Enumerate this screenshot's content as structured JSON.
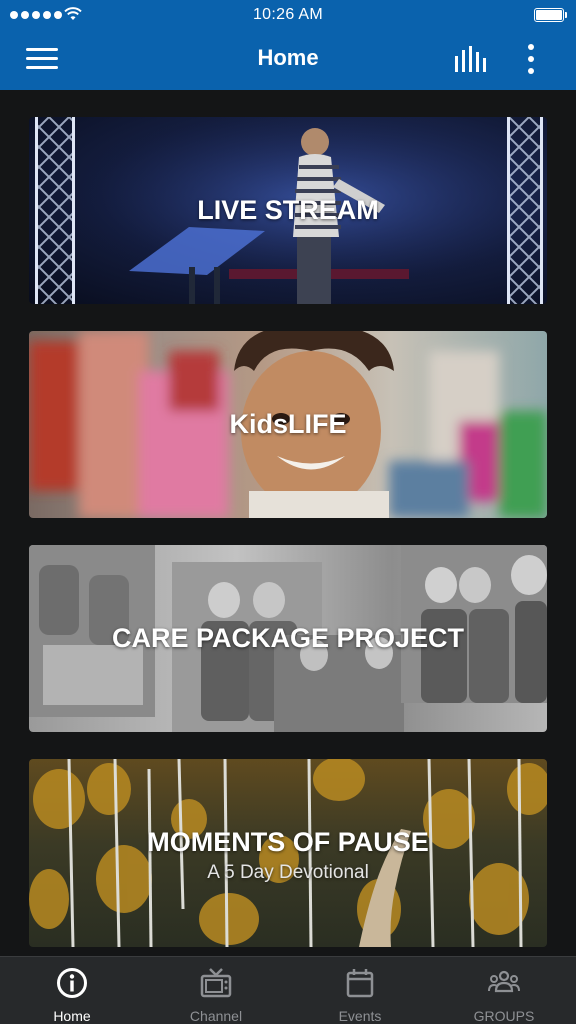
{
  "status_bar": {
    "time": "10:26 AM"
  },
  "nav": {
    "title": "Home"
  },
  "cards": [
    {
      "title": "LIVE STREAM",
      "subtitle": ""
    },
    {
      "title": "KidsLIFE",
      "subtitle": ""
    },
    {
      "title": "CARE PACKAGE PROJECT",
      "subtitle": ""
    },
    {
      "title": "MOMENTS OF PAUSE",
      "subtitle": "A 5 Day Devotional"
    }
  ],
  "tabs": [
    {
      "label": "Home",
      "icon": "info-icon",
      "active": true
    },
    {
      "label": "Channel",
      "icon": "tv-icon",
      "active": false
    },
    {
      "label": "Events",
      "icon": "calendar-icon",
      "active": false
    },
    {
      "label": "GROUPS",
      "icon": "group-icon",
      "active": false
    }
  ],
  "colors": {
    "nav_bar": "#0a62ad",
    "background": "#141516",
    "tab_bar": "#27292b",
    "tab_inactive": "#8e9094",
    "tab_active": "#ffffff"
  }
}
